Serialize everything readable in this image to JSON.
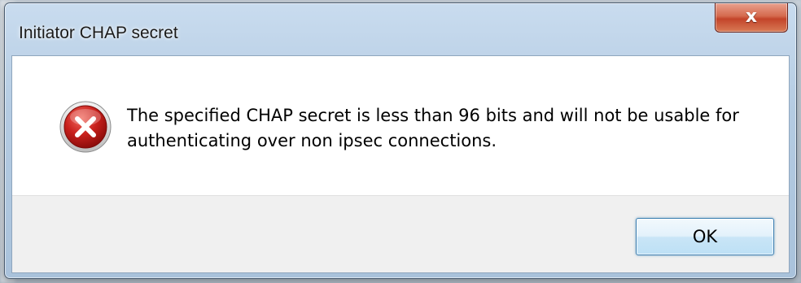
{
  "window": {
    "title": "Initiator CHAP secret",
    "close_symbol": "x",
    "close_icon": "close-icon"
  },
  "message": {
    "icon": "error-icon",
    "text": "The specified CHAP secret is less than 96 bits and will not be usable for authenticating over non ipsec connections."
  },
  "buttons": {
    "ok_label": "OK"
  },
  "colors": {
    "error_red": "#c8201c",
    "close_button": "#c3442a",
    "ok_border": "#3c7fb1",
    "titlebar": "#b4cbe2"
  }
}
